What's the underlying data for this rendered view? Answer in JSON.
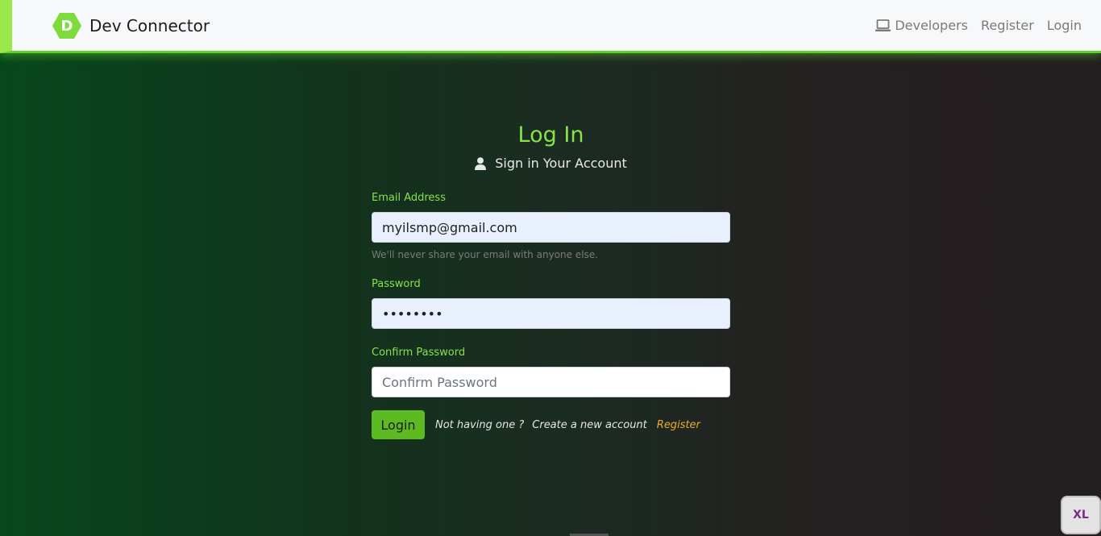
{
  "navbar": {
    "brand_letter": "D",
    "brand_name": "Dev Connector",
    "links": {
      "developers": "Developers",
      "register": "Register",
      "login": "Login"
    }
  },
  "form": {
    "title": "Log In",
    "subtitle": "Sign in Your Account",
    "email": {
      "label": "Email Address",
      "value": "myilsmp@gmail.com",
      "help": "We'll never share your email with anyone else."
    },
    "password": {
      "label": "Password",
      "value": "••••••••"
    },
    "confirm_password": {
      "label": "Confirm Password",
      "placeholder": "Confirm Password"
    },
    "login_button": "Login",
    "note": "Not having one ?",
    "note2": "Create a new account",
    "register_link": "Register"
  },
  "badge": "XL",
  "colors": {
    "accent_green": "#86e34a",
    "button_green": "#5dbb22",
    "register_orange": "#f0ab2a"
  }
}
